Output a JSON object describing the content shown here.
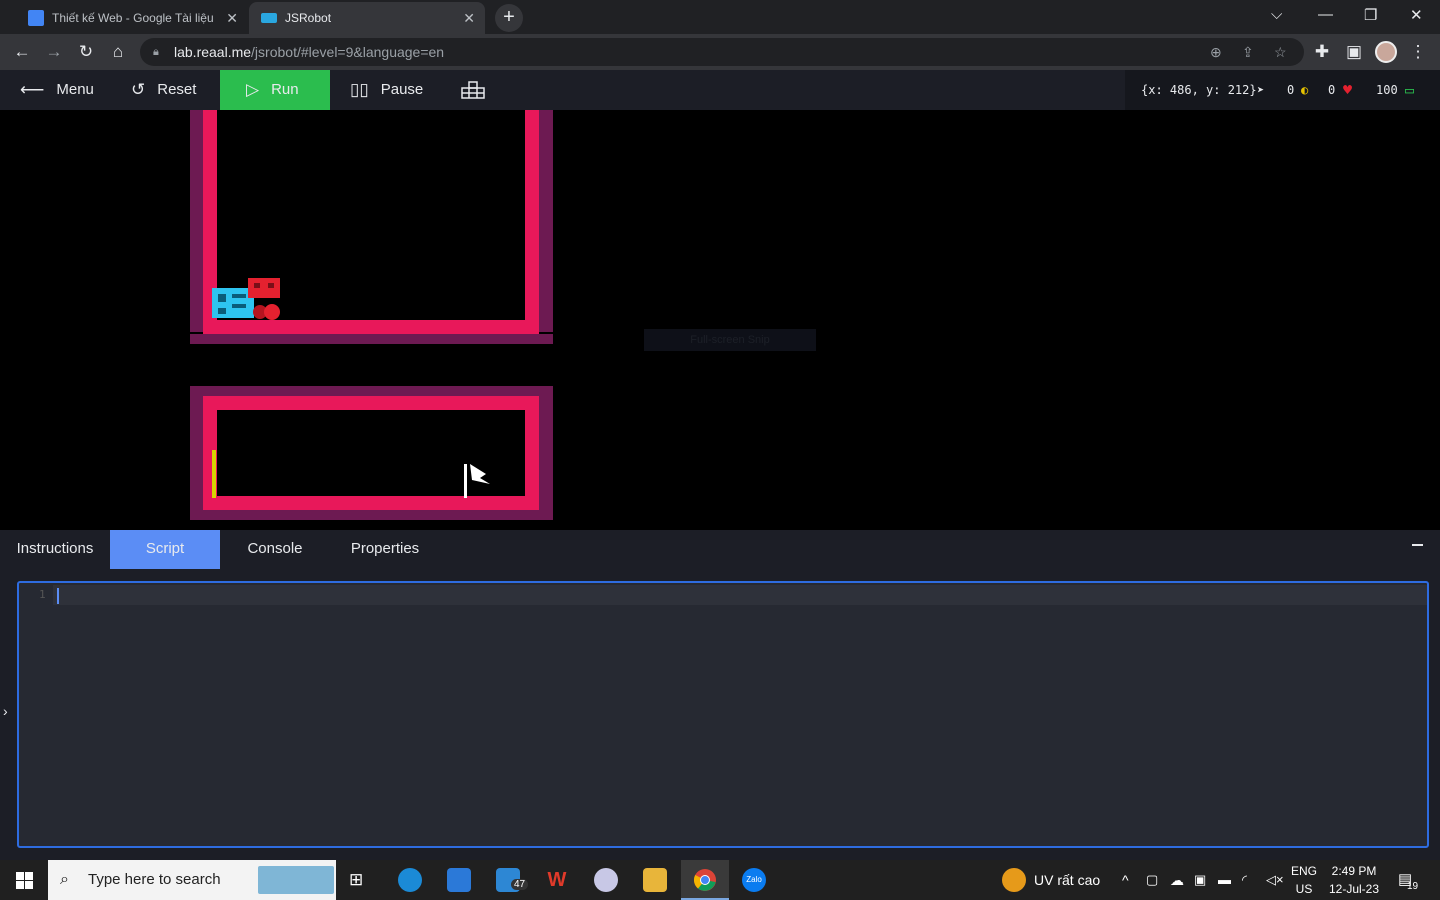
{
  "browser": {
    "tabs": [
      {
        "title": "Thiết kế Web - Google Tài liệu",
        "icon": "google-docs-icon",
        "color": "#4285f4"
      },
      {
        "title": "JSRobot",
        "icon": "jsrobot-icon",
        "color": "#2aa7e0"
      }
    ],
    "url_host": "lab.reaal.me",
    "url_path": "/jsrobot/#level=9&language=en"
  },
  "app": {
    "menu_label": "Menu",
    "reset_label": "Reset",
    "run_label": "Run",
    "pause_label": "Pause",
    "coords": "{x: 486, y: 212}",
    "coins": "0",
    "hearts": "0",
    "battery": "100",
    "snip_label": "Full-screen Snip"
  },
  "panel": {
    "tabs": [
      "Instructions",
      "Script",
      "Console",
      "Properties"
    ],
    "selected_tab": "Script",
    "line_number": "1"
  },
  "taskbar": {
    "search_placeholder": "Type here to search",
    "mail_badge": "47",
    "weather": "UV rất cao",
    "lang_top": "ENG",
    "lang_bottom": "US",
    "time": "2:49 PM",
    "date": "12-Jul-23",
    "notif_count": "19"
  },
  "colors": {
    "run_green": "#2bbd4e",
    "tab_blue": "#5b8df5",
    "wall_pink": "#e8185a",
    "wall_purple": "#6d1a52",
    "robot_blue": "#2ec4f0",
    "enemy_red": "#e4212f"
  }
}
